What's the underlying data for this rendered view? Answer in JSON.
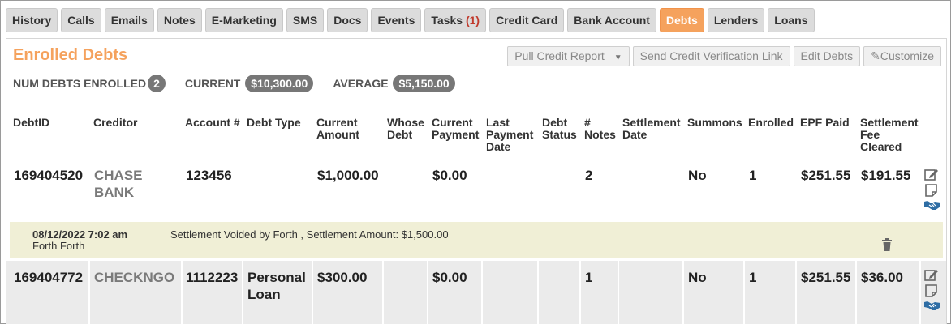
{
  "tabs": [
    {
      "label": "History"
    },
    {
      "label": "Calls"
    },
    {
      "label": "Emails"
    },
    {
      "label": "Notes"
    },
    {
      "label": "E-Marketing"
    },
    {
      "label": "SMS"
    },
    {
      "label": "Docs"
    },
    {
      "label": "Events"
    },
    {
      "label": "Tasks",
      "badge": "(1)"
    },
    {
      "label": "Credit Card"
    },
    {
      "label": "Bank Account"
    },
    {
      "label": "Debts",
      "active": true
    },
    {
      "label": "Lenders"
    },
    {
      "label": "Loans"
    }
  ],
  "section": {
    "title": "Enrolled Debts"
  },
  "actions": {
    "pull_credit_report": "Pull Credit Report",
    "send_verification": "Send Credit Verification Link",
    "edit_debts": "Edit Debts",
    "customize": "Customize"
  },
  "summary": {
    "num_label": "NUM DEBTS ENROLLED",
    "num_value": "2",
    "current_label": "CURRENT",
    "current_value": "$10,300.00",
    "average_label": "AVERAGE",
    "average_value": "$5,150.00"
  },
  "columns": {
    "debt_id": "DebtID",
    "creditor": "Creditor",
    "account": "Account #",
    "debt_type": "Debt Type",
    "current_amount_1": "Current",
    "current_amount_2": "Amount",
    "whose_1": "Whose",
    "whose_2": "Debt",
    "current_payment_1": "Current",
    "current_payment_2": "Payment",
    "last_payment_1": "Last",
    "last_payment_2": "Payment",
    "last_payment_3": "Date",
    "debt_status_1": "Debt",
    "debt_status_2": "Status",
    "notes_1": "#",
    "notes_2": "Notes",
    "settlement_date_1": "Settlement",
    "settlement_date_2": "Date",
    "summons": "Summons",
    "enrolled": "Enrolled",
    "epf_paid": "EPF Paid",
    "fee_cleared_1": "Settlement",
    "fee_cleared_2": "Fee",
    "fee_cleared_3": "Cleared"
  },
  "rows": [
    {
      "debt_id": "169404520",
      "creditor_1": "CHASE",
      "creditor_2": "BANK",
      "account": "123456",
      "debt_type_1": "",
      "debt_type_2": "",
      "current_amount": "$1,000.00",
      "current_payment": "$0.00",
      "notes": "2",
      "summons": "No",
      "enrolled": "1",
      "epf_paid": "$251.55",
      "fee_cleared": "$191.55"
    },
    {
      "debt_id": "169404772",
      "creditor_1": "CHECKNGO",
      "creditor_2": "",
      "account": "1112223",
      "debt_type_1": "Personal",
      "debt_type_2": "Loan",
      "current_amount": "$300.00",
      "current_payment": "$0.00",
      "notes": "1",
      "summons": "No",
      "enrolled": "1",
      "epf_paid": "$251.55",
      "fee_cleared": "$36.00"
    }
  ],
  "note": {
    "date": "08/12/2022 7:02 am",
    "author": "Forth Forth",
    "message": "Settlement Voided by Forth , Settlement Amount: $1,500.00"
  },
  "icons": {
    "edit": "edit-icon",
    "note": "note-icon",
    "settle": "handshake-icon",
    "trash": "trash-icon",
    "pencil": "pencil-icon"
  },
  "colors": {
    "accent": "#f5a25d",
    "pill": "#777777",
    "note_bg": "#f0efd6",
    "icon_blue": "#2e6da4"
  }
}
